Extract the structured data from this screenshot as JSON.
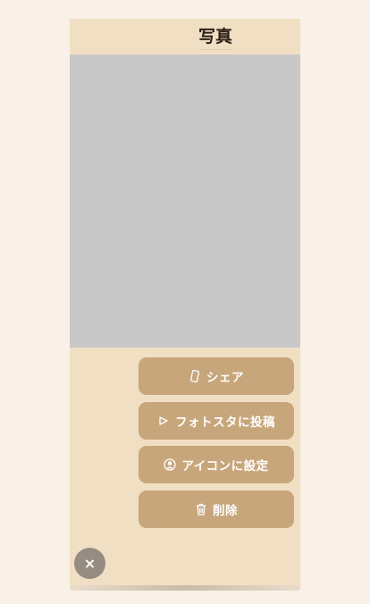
{
  "header": {
    "title": "写真"
  },
  "menu": {
    "items": [
      {
        "label": "シェア",
        "icon": "phone-icon"
      },
      {
        "label": "フォトスタに投稿",
        "icon": "send-icon"
      },
      {
        "label": "アイコンに設定",
        "icon": "avatar-icon"
      },
      {
        "label": "削除",
        "icon": "trash-icon"
      }
    ]
  },
  "close": {
    "label": "×",
    "icon": "close-icon"
  },
  "colors": {
    "background": "#f9f1e7",
    "panel": "#f1dfc4",
    "button": "#c8a67b",
    "close_button": "#978c82",
    "photo_placeholder": "#c8c8c8"
  }
}
